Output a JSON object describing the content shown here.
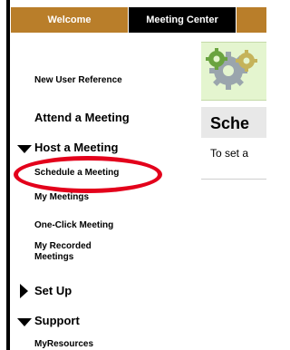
{
  "header": {
    "tabs": [
      {
        "label": "Welcome"
      },
      {
        "label": "Meeting Center"
      },
      {
        "label": ""
      }
    ]
  },
  "sidebar": {
    "items": [
      {
        "label": "New User Reference"
      },
      {
        "label": "Attend a Meeting"
      },
      {
        "label": "Host a Meeting",
        "expanded": true,
        "children": [
          {
            "label": "Schedule a Meeting",
            "highlighted": true
          },
          {
            "label": "My Meetings"
          },
          {
            "label": "One-Click Meeting"
          },
          {
            "label": "My Recorded Meetings"
          }
        ]
      },
      {
        "label": "Set Up",
        "expanded": false
      },
      {
        "label": "Support",
        "expanded": true,
        "children": [
          {
            "label": "MyResources"
          }
        ]
      }
    ]
  },
  "main": {
    "heading": "Sche",
    "intro": "To set a"
  },
  "colors": {
    "tab_accent": "#b97e2a",
    "tab_active": "#000000",
    "highlight_ring": "#e3001b",
    "banner_bg": "#e4f5cf",
    "heading_bg": "#e8e8e8"
  },
  "icons": [
    "gears-icon",
    "chevron-down-icon",
    "chevron-right-icon"
  ]
}
